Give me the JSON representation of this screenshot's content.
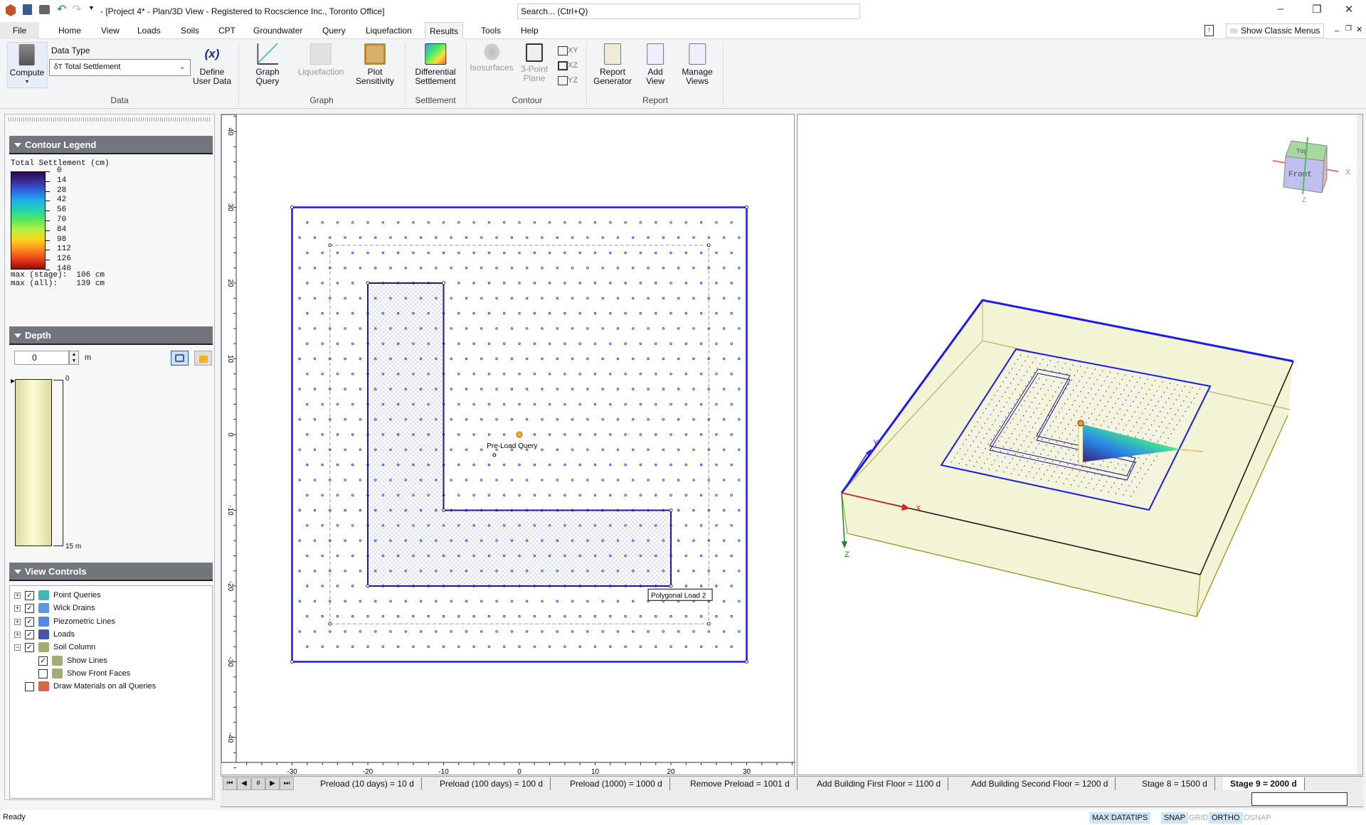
{
  "window": {
    "title": "- [Project 4* - Plan/3D View - Registered to Rocscience Inc., Toronto Office]",
    "search_placeholder": "Search... (Ctrl+Q)",
    "minimize": "–",
    "restore": "❐",
    "close": "✕"
  },
  "menu": {
    "tabs": [
      "File",
      "Home",
      "View",
      "Loads",
      "Soils",
      "CPT",
      "Groundwater",
      "Query",
      "Liquefaction",
      "Results",
      "Tools",
      "Help"
    ],
    "active": "Results",
    "show_classic_menus": "Show Classic Menus"
  },
  "ribbon": {
    "compute": "Compute",
    "data_type_label": "Data Type",
    "data_type_value": "Total Settlement",
    "data_type_symbol": "δT",
    "define_user_data": [
      "Define",
      "User Data"
    ],
    "graph_query": [
      "Graph",
      "Query"
    ],
    "liquefaction": [
      "Liquefaction",
      ""
    ],
    "plot_sensitivity": [
      "Plot",
      "Sensitivity"
    ],
    "differential_settlement": [
      "Differential",
      "Settlement"
    ],
    "isosurfaces": [
      "Isosurfaces",
      ""
    ],
    "three_point_plane": [
      "3-Point",
      "Plane"
    ],
    "planes": [
      "XY",
      "XZ",
      "YZ"
    ],
    "report_generator": [
      "Report",
      "Generator"
    ],
    "add_view": [
      "Add",
      "View"
    ],
    "manage_views": [
      "Manage",
      "Views"
    ],
    "groups": {
      "data": "Data",
      "graph": "Graph",
      "settlement": "Settlement",
      "contour": "Contour",
      "report": "Report"
    }
  },
  "legend": {
    "header": "Contour Legend",
    "title": "Total Settlement (cm)",
    "ticks": [
      "0",
      "14",
      "28",
      "42",
      "56",
      "70",
      "84",
      "98",
      "112",
      "126",
      "140"
    ],
    "max_stage": "max (stage):  106 cm",
    "max_all": "max (all):    139 cm",
    "colors": [
      "#2a0a4a",
      "#3a2f9a",
      "#2f6ae8",
      "#1fb4e6",
      "#22d6a8",
      "#5ee85a",
      "#b8f03c",
      "#ffd21f",
      "#ff8a1e",
      "#e8401a",
      "#9a0a0a"
    ]
  },
  "depth": {
    "header": "Depth",
    "value": "0",
    "unit": "m",
    "top_label": "0",
    "bottom_label": "15 m"
  },
  "view_controls": {
    "header": "View Controls",
    "items": [
      {
        "label": "Point Queries",
        "checked": true,
        "expand": "+"
      },
      {
        "label": "Wick Drains",
        "checked": true,
        "expand": "+"
      },
      {
        "label": "Piezometric Lines",
        "checked": true,
        "expand": "+"
      },
      {
        "label": "Loads",
        "checked": true,
        "expand": "+"
      },
      {
        "label": "Soil Column",
        "checked": true,
        "expand": "−"
      },
      {
        "label": "Show Lines",
        "checked": true,
        "expand": ""
      },
      {
        "label": "Show Front Faces",
        "checked": false,
        "expand": ""
      },
      {
        "label": "Draw Materials on all Queries",
        "checked": false,
        "expand": ""
      }
    ]
  },
  "plan": {
    "x_ticks": [
      "-30",
      "-20",
      "-10",
      "0",
      "10",
      "20",
      "30"
    ],
    "y_ticks": [
      "40",
      "30",
      "20",
      "10",
      "0",
      "-10",
      "-20",
      "-30",
      "-40"
    ],
    "query_label": "Pre-Load Query",
    "load_label": "Polygonal Load 2"
  },
  "view3d": {
    "axis_x": "X",
    "axis_y": "Y",
    "axis_z": "Z",
    "cube_top": "Top",
    "cube_front": "Front"
  },
  "stages": {
    "nav": [
      "⏮",
      "◀",
      "#",
      "▶",
      "⏭"
    ],
    "tabs": [
      "Preload (10 days) = 10 d",
      "Preload (100 days) = 100 d",
      "Preload (1000) = 1000 d",
      "Remove Preload = 1001 d",
      "Add Building First Floor = 1100 d",
      "Add Building Second Floor = 1200 d",
      "Stage 8 = 1500 d",
      "Stage 9 = 2000 d"
    ],
    "active": "Stage 9 = 2000 d"
  },
  "status": {
    "ready": "Ready",
    "max_datatips": "MAX DATATIPS",
    "snap": "SNAP",
    "grid": "GRID",
    "ortho": "ORTHO",
    "osnap": "OSNAP"
  }
}
